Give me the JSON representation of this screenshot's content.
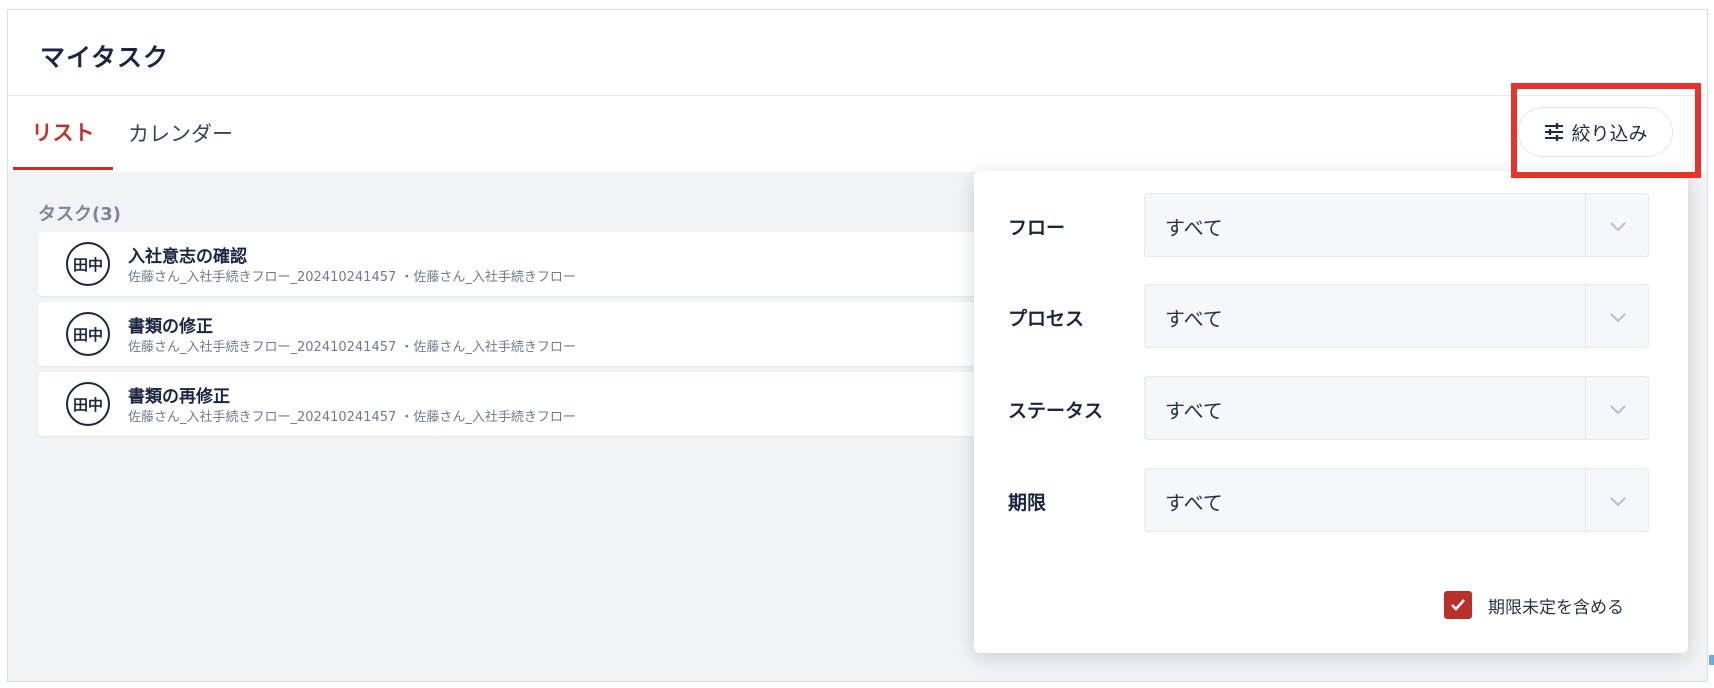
{
  "header": {
    "title": "マイタスク"
  },
  "tabs": [
    {
      "label": "リスト",
      "active": true
    },
    {
      "label": "カレンダー",
      "active": false
    }
  ],
  "filter_button": {
    "label": "絞り込み",
    "icon": "sliders-icon"
  },
  "tasks": {
    "label": "タスク(3)",
    "items": [
      {
        "assignee": "田中",
        "title": "入社意志の確認",
        "subtitle": "佐藤さん_入社手続きフロー_202410241457 ・佐藤さん_入社手続きフロー"
      },
      {
        "assignee": "田中",
        "title": "書類の修正",
        "subtitle": "佐藤さん_入社手続きフロー_202410241457 ・佐藤さん_入社手続きフロー"
      },
      {
        "assignee": "田中",
        "title": "書類の再修正",
        "subtitle": "佐藤さん_入社手続きフロー_202410241457 ・佐藤さん_入社手続きフロー"
      }
    ]
  },
  "filter_panel": {
    "fields": [
      {
        "label": "フロー",
        "value": "すべて"
      },
      {
        "label": "プロセス",
        "value": "すべて"
      },
      {
        "label": "ステータス",
        "value": "すべて"
      },
      {
        "label": "期限",
        "value": "すべて"
      }
    ],
    "include_undecided": {
      "label": "期限未定を含める",
      "checked": true
    }
  },
  "colors": {
    "accent": "#c4302b",
    "highlight": "#e8322a",
    "text": "#1c2640"
  }
}
